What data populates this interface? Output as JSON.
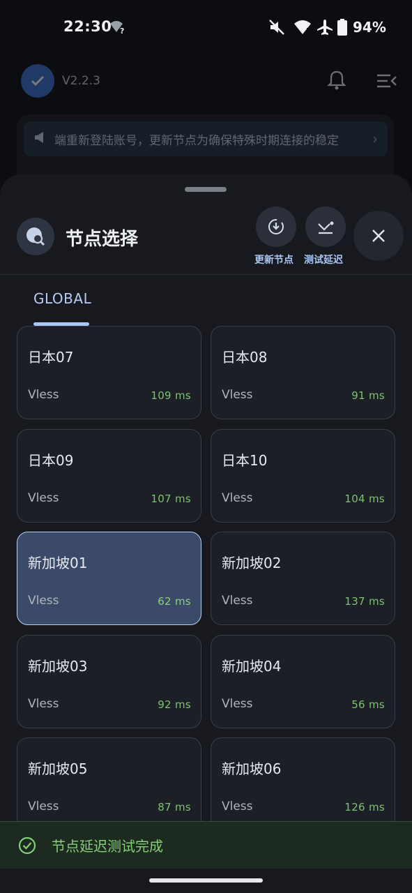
{
  "status": {
    "time": "22:30",
    "battery": "94%"
  },
  "header": {
    "version": "V2.2.3"
  },
  "notice": {
    "text": "端重新登陆账号，更新节点为确保特殊时期连接的稳定"
  },
  "sheet": {
    "title": "节点选择",
    "update_label": "更新节点",
    "test_label": "测试延迟",
    "tab": "GLOBAL"
  },
  "nodes": [
    {
      "name": "日本07",
      "protocol": "Vless",
      "latency": "109 ms"
    },
    {
      "name": "日本08",
      "protocol": "Vless",
      "latency": "91 ms"
    },
    {
      "name": "日本09",
      "protocol": "Vless",
      "latency": "107 ms"
    },
    {
      "name": "日本10",
      "protocol": "Vless",
      "latency": "104 ms"
    },
    {
      "name": "新加坡01",
      "protocol": "Vless",
      "latency": "62 ms",
      "selected": true
    },
    {
      "name": "新加坡02",
      "protocol": "Vless",
      "latency": "137 ms"
    },
    {
      "name": "新加坡03",
      "protocol": "Vless",
      "latency": "92 ms"
    },
    {
      "name": "新加坡04",
      "protocol": "Vless",
      "latency": "56 ms"
    },
    {
      "name": "新加坡05",
      "protocol": "Vless",
      "latency": "87 ms"
    },
    {
      "name": "新加坡06",
      "protocol": "Vless",
      "latency": "126 ms"
    }
  ],
  "snackbar": {
    "text": "节点延迟测试完成"
  },
  "colors": {
    "accent": "#a9c6f5",
    "success": "#7cc46e",
    "selected_bg": "#3a4a68"
  }
}
